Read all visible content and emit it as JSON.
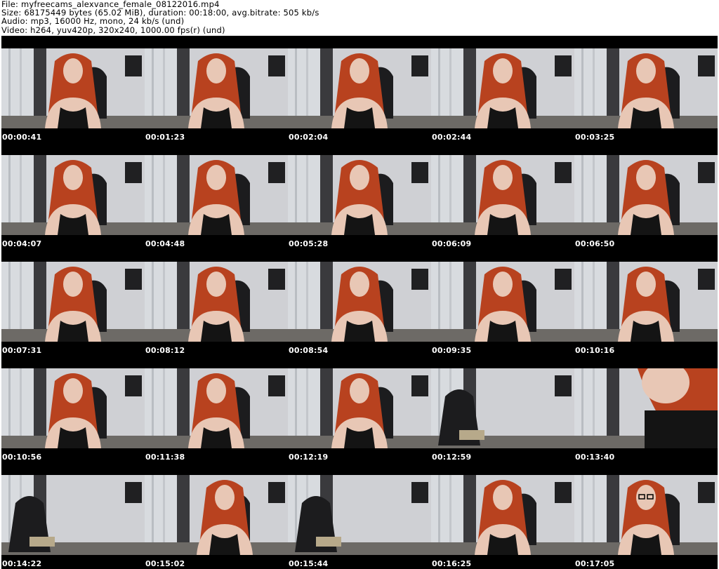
{
  "header": {
    "file_line": "File: myfreecams_alexvance_female_08122016.mp4",
    "size_line": "Size: 68175449 bytes (65.02 MiB), duration: 00:18:00, avg.bitrate: 505 kb/s",
    "audio_line": "Audio: mp3, 16000 Hz, mono, 24 kb/s (und)",
    "video_line": "Video: h264, yuv420p, 320x240, 1000.00 fps(r) (und)"
  },
  "thumbnails": [
    {
      "timestamp": "00:00:41",
      "scene": "person"
    },
    {
      "timestamp": "00:01:23",
      "scene": "person"
    },
    {
      "timestamp": "00:02:04",
      "scene": "person"
    },
    {
      "timestamp": "00:02:44",
      "scene": "person"
    },
    {
      "timestamp": "00:03:25",
      "scene": "person"
    },
    {
      "timestamp": "00:04:07",
      "scene": "person"
    },
    {
      "timestamp": "00:04:48",
      "scene": "person"
    },
    {
      "timestamp": "00:05:28",
      "scene": "person"
    },
    {
      "timestamp": "00:06:09",
      "scene": "person"
    },
    {
      "timestamp": "00:06:50",
      "scene": "person"
    },
    {
      "timestamp": "00:07:31",
      "scene": "person"
    },
    {
      "timestamp": "00:08:12",
      "scene": "person"
    },
    {
      "timestamp": "00:08:54",
      "scene": "person"
    },
    {
      "timestamp": "00:09:35",
      "scene": "person"
    },
    {
      "timestamp": "00:10:16",
      "scene": "person"
    },
    {
      "timestamp": "00:10:56",
      "scene": "person"
    },
    {
      "timestamp": "00:11:38",
      "scene": "person"
    },
    {
      "timestamp": "00:12:19",
      "scene": "person"
    },
    {
      "timestamp": "00:12:59",
      "scene": "empty-room"
    },
    {
      "timestamp": "00:13:40",
      "scene": "close-up"
    },
    {
      "timestamp": "00:14:22",
      "scene": "empty-room"
    },
    {
      "timestamp": "00:15:02",
      "scene": "person-leaning"
    },
    {
      "timestamp": "00:15:44",
      "scene": "empty-room"
    },
    {
      "timestamp": "00:16:25",
      "scene": "person"
    },
    {
      "timestamp": "00:17:05",
      "scene": "person-glasses"
    }
  ],
  "colors": {
    "hair": "#b8421f",
    "skin": "#e8c7b5",
    "wall": "#cfd0d4",
    "curtain": "#d8dbdf",
    "chair": "#1c1c1e",
    "clothing": "#141414"
  }
}
